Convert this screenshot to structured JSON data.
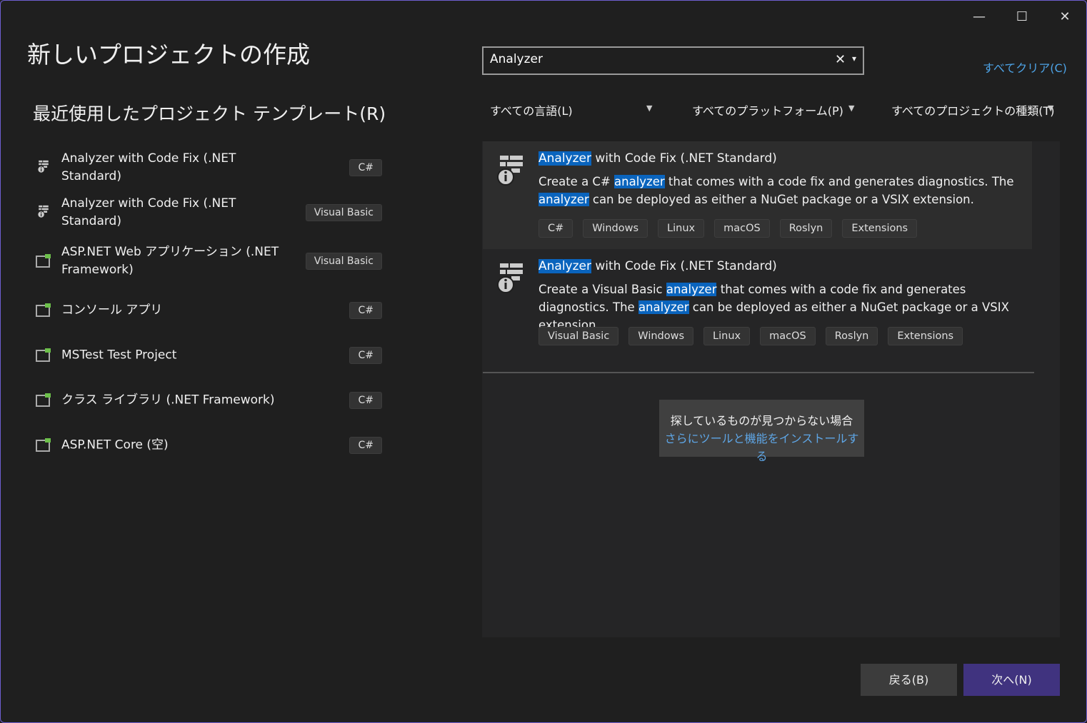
{
  "window": {
    "minimize": "—",
    "maximize": "☐",
    "close": "✕"
  },
  "title": "新しいプロジェクトの作成",
  "recent": {
    "heading": "最近使用したプロジェクト テンプレート(R)",
    "items": [
      {
        "label": "Analyzer with Code Fix (.NET Standard)",
        "lang": "C#",
        "icon": "analyzer-icon"
      },
      {
        "label": "Analyzer with Code Fix (.NET Standard)",
        "lang": "Visual Basic",
        "icon": "analyzer-icon"
      },
      {
        "label": "ASP.NET Web アプリケーション (.NET Framework)",
        "lang": "Visual Basic",
        "icon": "web-app-vb-icon"
      },
      {
        "label": "コンソール アプリ",
        "lang": "C#",
        "icon": "console-app-icon"
      },
      {
        "label": "MSTest Test Project",
        "lang": "C#",
        "icon": "test-project-icon"
      },
      {
        "label": "クラス ライブラリ (.NET Framework)",
        "lang": "C#",
        "icon": "class-library-icon"
      },
      {
        "label": "ASP.NET Core (空)",
        "lang": "C#",
        "icon": "aspnet-core-icon"
      }
    ]
  },
  "search": {
    "value": "Analyzer",
    "clear": "✕",
    "dropdown": "▾"
  },
  "clear_all": "すべてクリア(C)",
  "filters": {
    "language": "すべての言語(L)",
    "platform": "すべてのプラットフォーム(P)",
    "project_type": "すべてのプロジェクトの種類(T)",
    "arrow": "▼"
  },
  "results": [
    {
      "title": [
        {
          "text": "Analyzer",
          "hl": true
        },
        {
          "text": " with Code Fix (.NET Standard)",
          "hl": false
        }
      ],
      "desc": [
        {
          "text": "Create a C# ",
          "hl": false
        },
        {
          "text": "analyzer",
          "hl": true
        },
        {
          "text": " that comes with a code fix and generates diagnostics. The ",
          "hl": false
        },
        {
          "text": "analyzer",
          "hl": true
        },
        {
          "text": " can be deployed as either a NuGet package or a VSIX extension.",
          "hl": false
        }
      ],
      "tags": [
        "C#",
        "Windows",
        "Linux",
        "macOS",
        "Roslyn",
        "Extensions"
      ],
      "selected": true
    },
    {
      "title": [
        {
          "text": "Analyzer",
          "hl": true
        },
        {
          "text": " with Code Fix (.NET Standard)",
          "hl": false
        }
      ],
      "desc": [
        {
          "text": "Create a Visual Basic ",
          "hl": false
        },
        {
          "text": "analyzer",
          "hl": true
        },
        {
          "text": " that comes with a code fix and generates diagnostics. The ",
          "hl": false
        },
        {
          "text": "analyzer",
          "hl": true
        },
        {
          "text": " can be deployed as either a NuGet package or a VSIX extension.",
          "hl": false
        }
      ],
      "tags": [
        "Visual Basic",
        "Windows",
        "Linux",
        "macOS",
        "Roslyn",
        "Extensions"
      ],
      "selected": false
    }
  ],
  "info": {
    "text": "探しているものが見つからない場合",
    "link": "さらにツールと機能をインストールする"
  },
  "buttons": {
    "back": "戻る(B)",
    "next": "次へ(N)"
  },
  "colors": {
    "accent": "#40337f",
    "highlight": "#0a64bd",
    "link": "#4da3e6",
    "border": "#6e5fd0"
  }
}
